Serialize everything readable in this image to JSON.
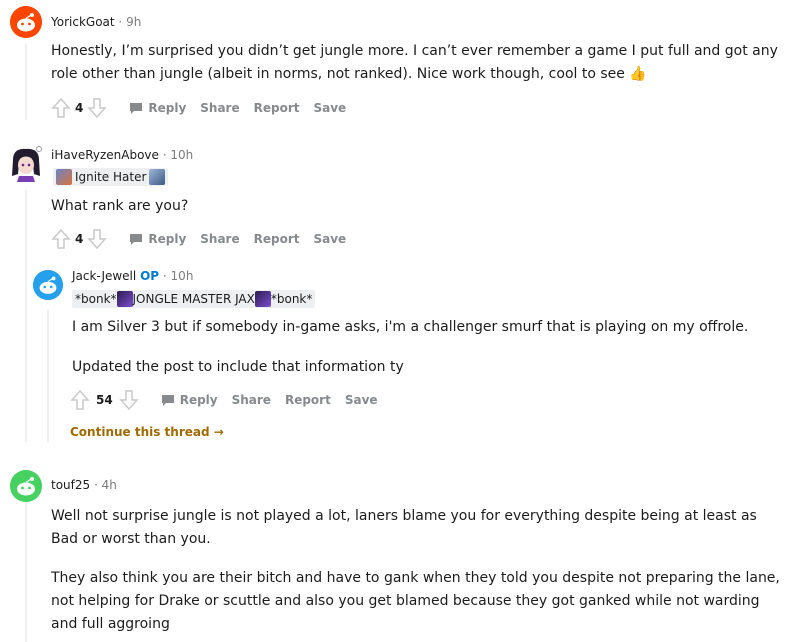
{
  "comments": [
    {
      "username": "YorickGoat",
      "time": "9h",
      "body": "Honestly, I’m surprised you didn’t get jungle more. I can’t ever remember a game I put full and got any role other than jungle (albeit in norms, not ranked). Nice work though, cool to see",
      "thumb": "👍",
      "votes": "4"
    },
    {
      "username": "iHaveRyzenAbove",
      "time": "10h",
      "flair": "Ignite Hater",
      "body": "What rank are you?",
      "votes": "4"
    },
    {
      "username": "Jack-Jewell",
      "op": "OP",
      "time": "10h",
      "flair_parts": [
        "*bonk*",
        "JONGLE MASTER JAX",
        "*bonk*"
      ],
      "body1": "I am Silver 3 but if somebody in-game asks, i'm a challenger smurf that is playing on my offrole.",
      "body2": "Updated the post to include that information ty",
      "votes": "54"
    },
    {
      "username": "touf25",
      "time": "4h",
      "body1": "Well not surprise jungle is not played a lot, laners blame you for everything despite being at least as Bad or worst than you.",
      "body2": "They also think you are their bitch and have to gank when they told you despite not preparing the lane, not helping for Drake or scuttle and also you get blamed because they got ganked while not warding and full aggroing"
    }
  ],
  "actions": {
    "reply": "Reply",
    "share": "Share",
    "report": "Report",
    "save": "Save"
  },
  "continue_thread": "Continue this thread",
  "continue_arrow": "→",
  "time_separator": "·",
  "colors": {
    "accent_op": "#0079d3",
    "continue": "#a16a00",
    "meta": "#7c7c7c",
    "action": "#878a8c",
    "thread_line": "#edeff1",
    "avatar_red": "#ff4500",
    "avatar_blue": "#24a0ed",
    "avatar_green": "#46d160"
  }
}
